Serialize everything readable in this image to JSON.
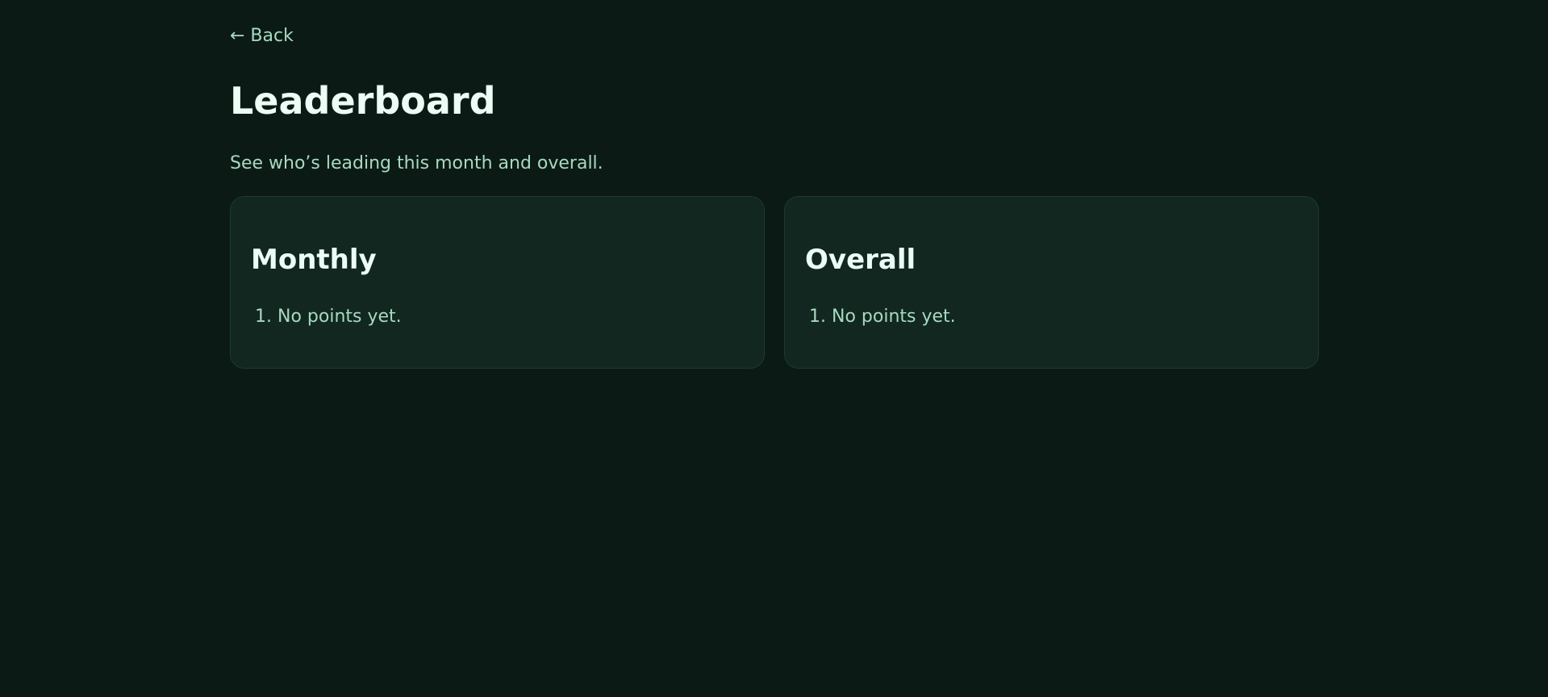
{
  "nav": {
    "back_label": "← Back"
  },
  "header": {
    "title": "Leaderboard",
    "subtitle": "See who’s leading this month and overall."
  },
  "cards": [
    {
      "title": "Monthly",
      "entries": [
        {
          "rank": "1.",
          "text": "No points yet."
        }
      ]
    },
    {
      "title": "Overall",
      "entries": [
        {
          "rank": "1.",
          "text": "No points yet."
        }
      ]
    }
  ],
  "colors": {
    "background": "#0c1a15",
    "card_background": "#11271f",
    "card_border": "#1f3a2f",
    "heading_text": "#ecfdf5",
    "muted_text": "#a8d9c0"
  }
}
